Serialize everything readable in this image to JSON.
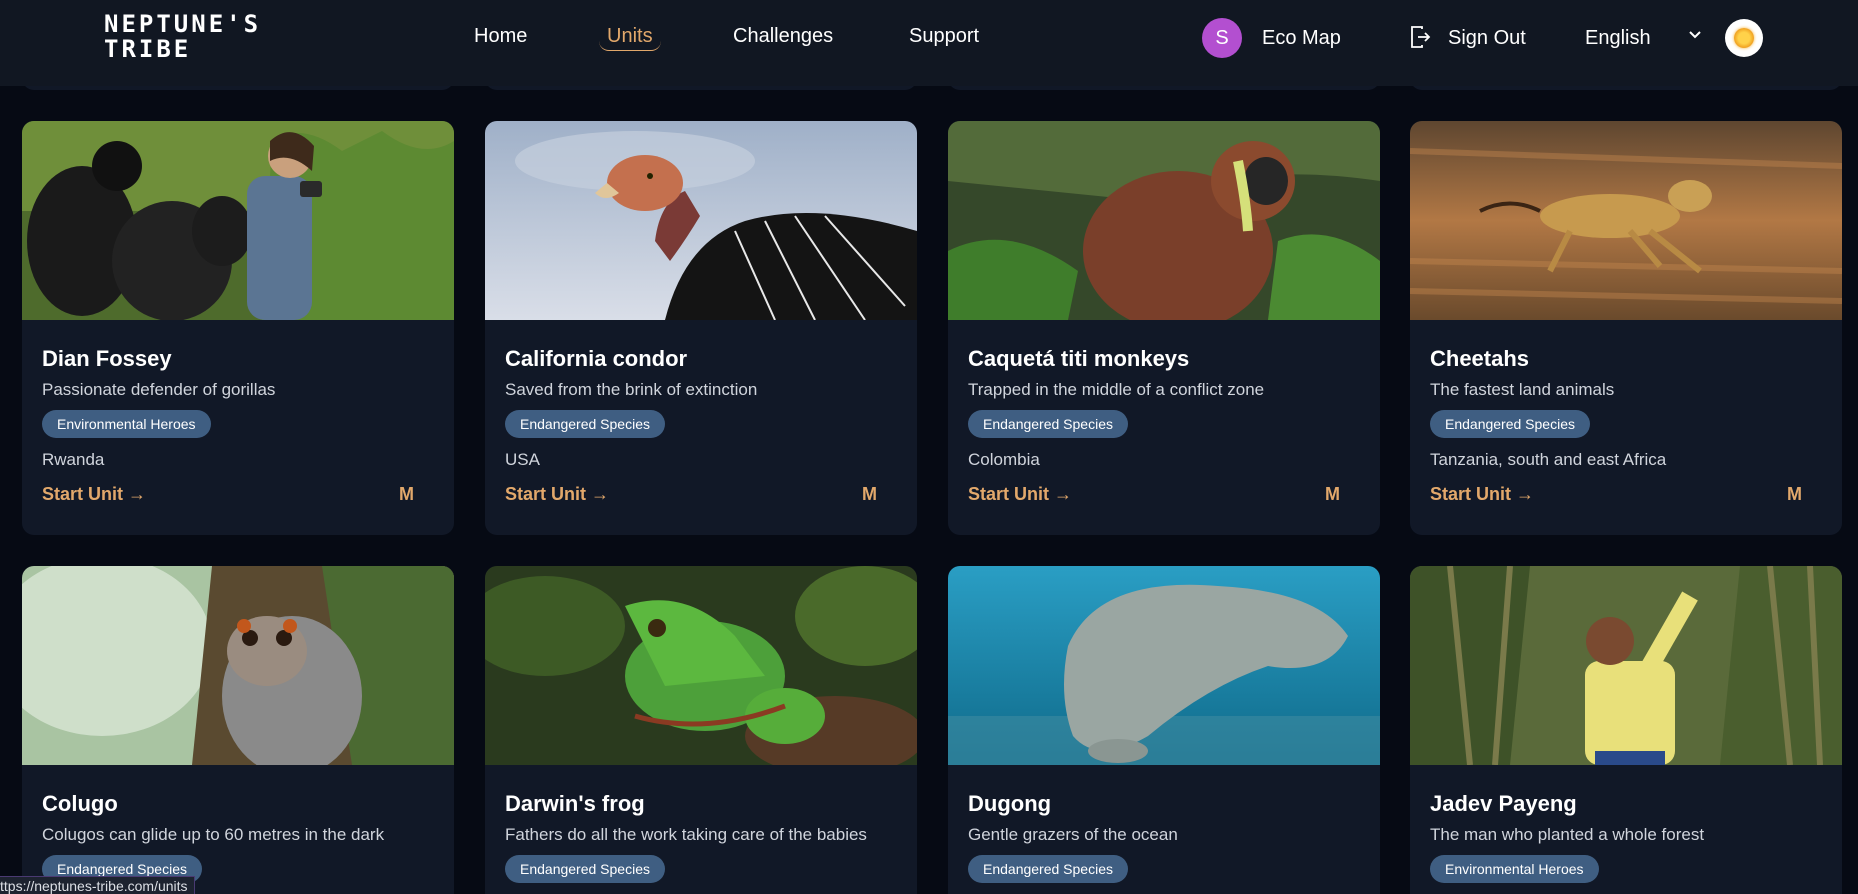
{
  "header": {
    "logo_line1": "NEPTUNE'S",
    "logo_line2": "TRIBE",
    "nav": [
      {
        "label": "Home"
      },
      {
        "label": "Units"
      },
      {
        "label": "Challenges"
      },
      {
        "label": "Support"
      }
    ],
    "active_nav": "Units",
    "avatar_initial": "S",
    "eco_map": "Eco Map",
    "sign_out": "Sign Out",
    "language": "English"
  },
  "cards": [
    {
      "title": "Dian Fossey",
      "subtitle": "Passionate defender of gorillas",
      "tag": "Environmental Heroes",
      "location": "Rwanda",
      "cta": "Start Unit →",
      "size": "M"
    },
    {
      "title": "California condor",
      "subtitle": "Saved from the brink of extinction",
      "tag": "Endangered Species",
      "location": "USA",
      "cta": "Start Unit →",
      "size": "M"
    },
    {
      "title": "Caquetá titi monkeys",
      "subtitle": "Trapped in the middle of a conflict zone",
      "tag": "Endangered Species",
      "location": "Colombia",
      "cta": "Start Unit →",
      "size": "M"
    },
    {
      "title": "Cheetahs",
      "subtitle": "The fastest land animals",
      "tag": "Endangered Species",
      "location": "Tanzania, south and east Africa",
      "cta": "Start Unit →",
      "size": "M"
    },
    {
      "title": "Colugo",
      "subtitle": "Colugos can glide up to 60 metres in the dark",
      "tag": "Endangered Species"
    },
    {
      "title": "Darwin's frog",
      "subtitle": "Fathers do all the work taking care of the babies",
      "tag": "Endangered Species"
    },
    {
      "title": "Dugong",
      "subtitle": "Gentle grazers of the ocean",
      "tag": "Endangered Species"
    },
    {
      "title": "Jadev Payeng",
      "subtitle": "The man who planted a whole forest",
      "tag": "Environmental Heroes"
    }
  ],
  "status_url": "ttps://neptunes-tribe.com/units",
  "colors": {
    "accent": "#e2a86b",
    "card_bg": "#111827",
    "tag_bg": "#3f5e82",
    "page_bg": "#060a14"
  }
}
